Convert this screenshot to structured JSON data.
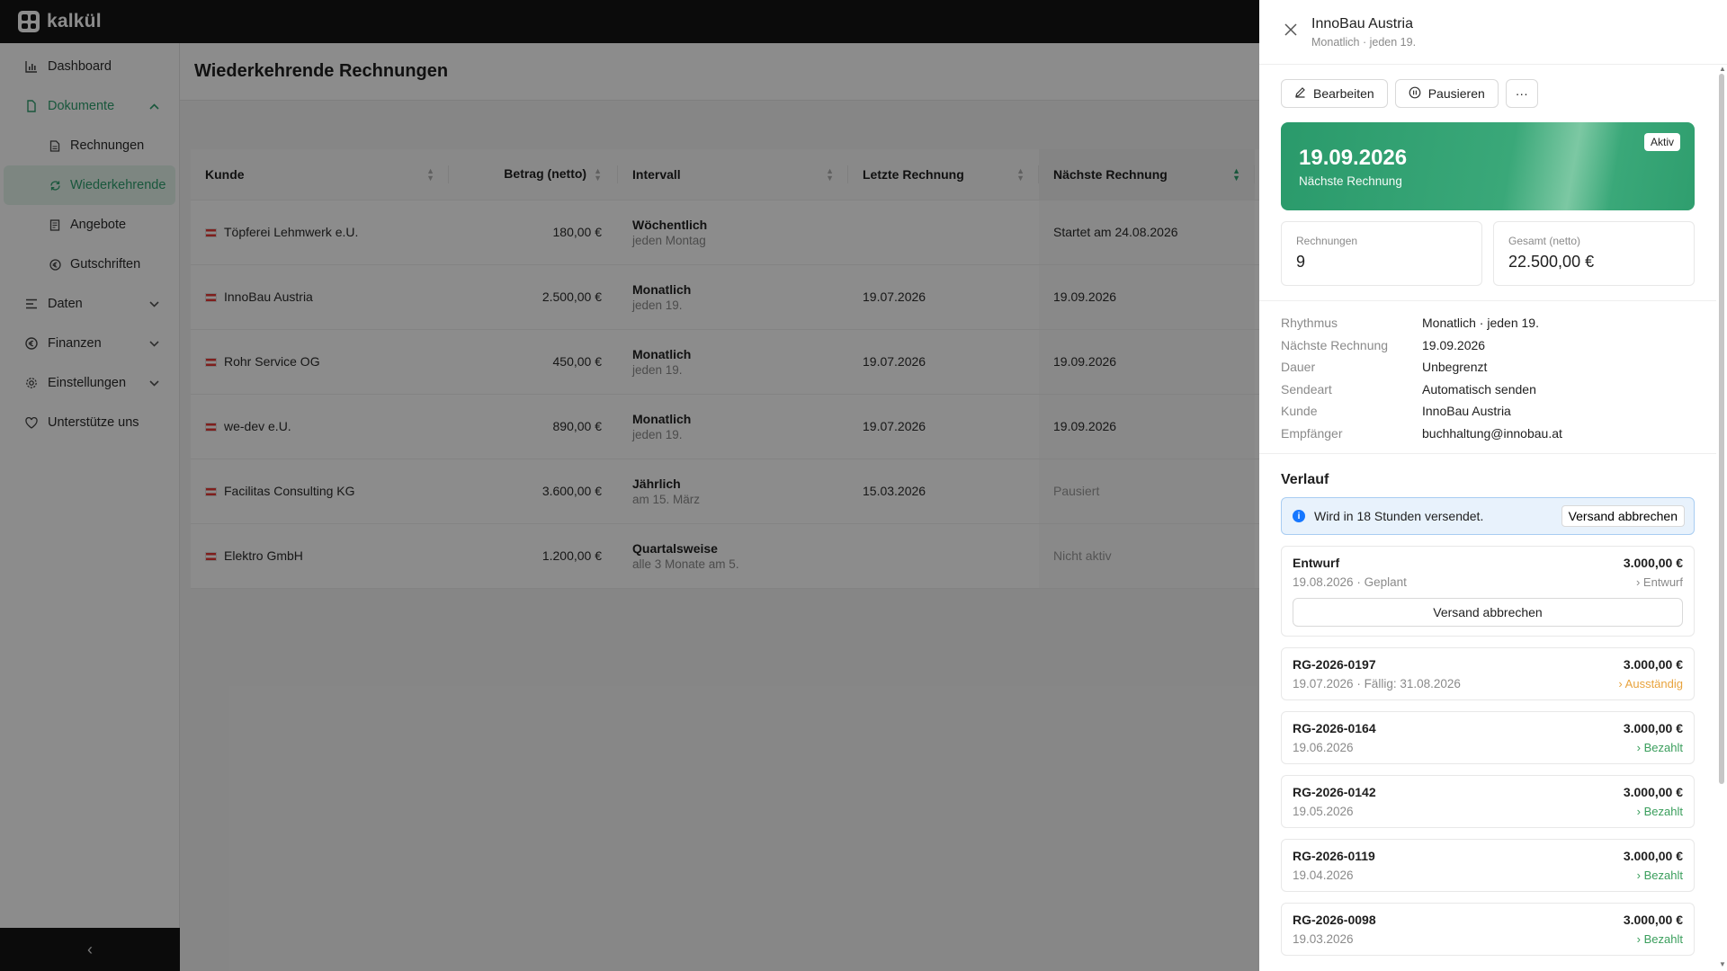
{
  "app": {
    "name": "kalkül"
  },
  "sidebar": {
    "items": [
      {
        "label": "Dashboard"
      },
      {
        "label": "Dokumente"
      },
      {
        "label": "Daten"
      },
      {
        "label": "Finanzen"
      },
      {
        "label": "Einstellungen"
      },
      {
        "label": "Unterstütze uns"
      }
    ],
    "sub": [
      {
        "label": "Rechnungen"
      },
      {
        "label": "Wiederkehrende"
      },
      {
        "label": "Angebote"
      },
      {
        "label": "Gutschriften"
      }
    ],
    "collapse_icon": "‹"
  },
  "page": {
    "title": "Wiederkehrende Rechnungen"
  },
  "table": {
    "headers": [
      "Kunde",
      "Betrag (netto)",
      "Intervall",
      "Letzte Rechnung",
      "Nächste Rechnung"
    ],
    "rows": [
      {
        "kunde": "Töpferei Lehmwerk e.U.",
        "betrag": "180,00 €",
        "intervall": "Wöchentlich",
        "intervall_sub": "jeden Montag",
        "letzte": "",
        "naechste": "Startet am 24.08.2026"
      },
      {
        "kunde": "InnoBau Austria",
        "betrag": "2.500,00 €",
        "intervall": "Monatlich",
        "intervall_sub": "jeden 19.",
        "letzte": "19.07.2026",
        "naechste": "19.09.2026"
      },
      {
        "kunde": "Rohr Service OG",
        "betrag": "450,00 €",
        "intervall": "Monatlich",
        "intervall_sub": "jeden 19.",
        "letzte": "19.07.2026",
        "naechste": "19.09.2026"
      },
      {
        "kunde": "we-dev e.U.",
        "betrag": "890,00 €",
        "intervall": "Monatlich",
        "intervall_sub": "jeden 19.",
        "letzte": "19.07.2026",
        "naechste": "19.09.2026"
      },
      {
        "kunde": "Facilitas Consulting KG",
        "betrag": "3.600,00 €",
        "intervall": "Jährlich",
        "intervall_sub": "am 15. März",
        "letzte": "15.03.2026",
        "naechste": "Pausiert"
      },
      {
        "kunde": "Elektro GmbH",
        "betrag": "1.200,00 €",
        "intervall": "Quartalsweise",
        "intervall_sub": "alle 3 Monate am 5.",
        "letzte": "",
        "naechste": "Nicht aktiv"
      }
    ]
  },
  "drawer": {
    "title": "InnoBau Austria",
    "subtitle": "Monatlich · jeden 19.",
    "actions": {
      "edit": "Bearbeiten",
      "pause": "Pausieren",
      "more": "···"
    },
    "hero": {
      "date": "19.09.2026",
      "label": "Nächste Rechnung",
      "badge": "Aktiv"
    },
    "stats": [
      {
        "label": "Rechnungen",
        "value": "9"
      },
      {
        "label": "Gesamt (netto)",
        "value": "22.500,00 €"
      }
    ],
    "details": [
      {
        "key": "Rhythmus",
        "value": "Monatlich · jeden 19."
      },
      {
        "key": "Nächste Rechnung",
        "value": "19.09.2026"
      },
      {
        "key": "Dauer",
        "value": "Unbegrenzt"
      },
      {
        "key": "Sendeart",
        "value": "Automatisch senden"
      },
      {
        "key": "Kunde",
        "value": "InnoBau Austria"
      },
      {
        "key": "Empfänger",
        "value": "buchhaltung@innobau.at"
      }
    ],
    "verlauf": {
      "title": "Verlauf",
      "info": "Wird in 18 Stunden versendet.",
      "info_button": "Versand abbrechen",
      "entries": [
        {
          "title": "Entwurf",
          "amount": "3.000,00 €",
          "meta": "19.08.2026 · Geplant",
          "status": "Entwurf",
          "button": "Versand abbrechen"
        },
        {
          "title": "RG-2026-0197",
          "amount": "3.000,00 €",
          "meta": "19.07.2026 · Fällig: 31.08.2026",
          "status": "Ausständig"
        },
        {
          "title": "RG-2026-0164",
          "amount": "3.000,00 €",
          "meta": "19.06.2026",
          "status": "Bezahlt"
        },
        {
          "title": "RG-2026-0142",
          "amount": "3.000,00 €",
          "meta": "19.05.2026",
          "status": "Bezahlt"
        },
        {
          "title": "RG-2026-0119",
          "amount": "3.000,00 €",
          "meta": "19.04.2026",
          "status": "Bezahlt"
        },
        {
          "title": "RG-2026-0098",
          "amount": "3.000,00 €",
          "meta": "19.03.2026",
          "status": "Bezahlt"
        }
      ]
    }
  },
  "colors": {
    "accent": "#2f9e6e",
    "topbar": "#141414",
    "info": "#1677ff",
    "warning": "#e8a33d",
    "success": "#3a9e5c"
  }
}
